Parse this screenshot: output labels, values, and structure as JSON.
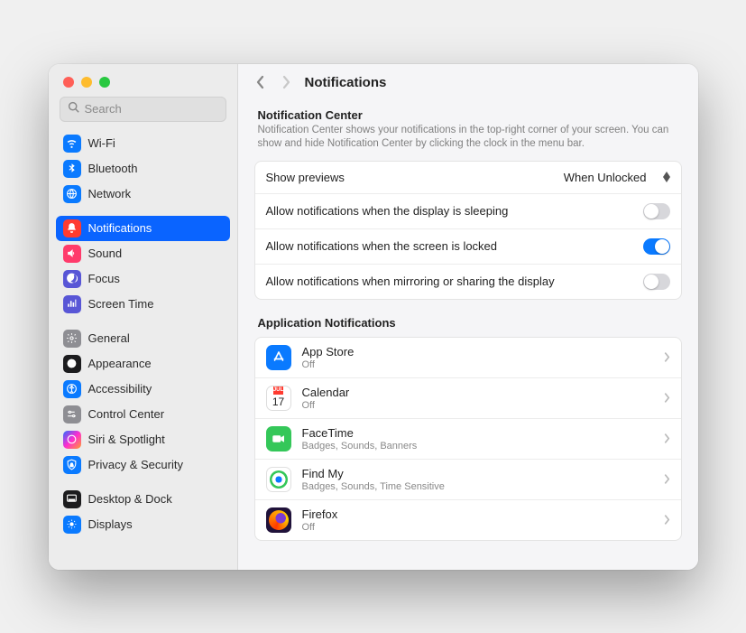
{
  "search": {
    "placeholder": "Search"
  },
  "sidebar": {
    "groups": [
      {
        "items": [
          {
            "id": "wifi",
            "label": "Wi-Fi",
            "bg": "#0a7aff"
          },
          {
            "id": "bluetooth",
            "label": "Bluetooth",
            "bg": "#0a7aff"
          },
          {
            "id": "network",
            "label": "Network",
            "bg": "#0a7aff"
          }
        ]
      },
      {
        "items": [
          {
            "id": "notifications",
            "label": "Notifications",
            "bg": "#ff3b30",
            "selected": true
          },
          {
            "id": "sound",
            "label": "Sound",
            "bg": "#ff3b6b"
          },
          {
            "id": "focus",
            "label": "Focus",
            "bg": "#5856d6"
          },
          {
            "id": "screen-time",
            "label": "Screen Time",
            "bg": "#5856d6"
          }
        ]
      },
      {
        "items": [
          {
            "id": "general",
            "label": "General",
            "bg": "#8e8e93"
          },
          {
            "id": "appearance",
            "label": "Appearance",
            "bg": "#1c1c1e"
          },
          {
            "id": "accessibility",
            "label": "Accessibility",
            "bg": "#0a7aff"
          },
          {
            "id": "control-center",
            "label": "Control Center",
            "bg": "#8e8e93"
          },
          {
            "id": "siri-spotlight",
            "label": "Siri & Spotlight",
            "bg": "linear-gradient(135deg,#2b6bff,#ff2dd0,#ff9e2d)"
          },
          {
            "id": "privacy-security",
            "label": "Privacy & Security",
            "bg": "#0a7aff"
          }
        ]
      },
      {
        "items": [
          {
            "id": "desktop-dock",
            "label": "Desktop & Dock",
            "bg": "#1c1c1e"
          },
          {
            "id": "displays",
            "label": "Displays",
            "bg": "#0a7aff"
          }
        ]
      }
    ]
  },
  "header": {
    "title": "Notifications"
  },
  "nc": {
    "title": "Notification Center",
    "desc": "Notification Center shows your notifications in the top-right corner of your screen. You can show and hide Notification Center by clicking the clock in the menu bar."
  },
  "settings": [
    {
      "id": "show-previews",
      "label": "Show previews",
      "type": "select",
      "value": "When Unlocked"
    },
    {
      "id": "allow-sleeping",
      "label": "Allow notifications when the display is sleeping",
      "type": "toggle",
      "on": false
    },
    {
      "id": "allow-locked",
      "label": "Allow notifications when the screen is locked",
      "type": "toggle",
      "on": true
    },
    {
      "id": "allow-mirroring",
      "label": "Allow notifications when mirroring or sharing the display",
      "type": "toggle",
      "on": false
    }
  ],
  "appsTitle": "Application Notifications",
  "apps": [
    {
      "id": "app-store",
      "name": "App Store",
      "sub": "Off",
      "iconType": "appstore",
      "bg": "#0a7aff"
    },
    {
      "id": "calendar",
      "name": "Calendar",
      "sub": "Off",
      "iconType": "calendar",
      "month": "JUL",
      "day": "17"
    },
    {
      "id": "facetime",
      "name": "FaceTime",
      "sub": "Badges, Sounds, Banners",
      "iconType": "facetime",
      "bg": "#34c759"
    },
    {
      "id": "find-my",
      "name": "Find My",
      "sub": "Badges, Sounds, Time Sensitive",
      "iconType": "findmy"
    },
    {
      "id": "firefox",
      "name": "Firefox",
      "sub": "Off",
      "iconType": "firefox"
    }
  ]
}
